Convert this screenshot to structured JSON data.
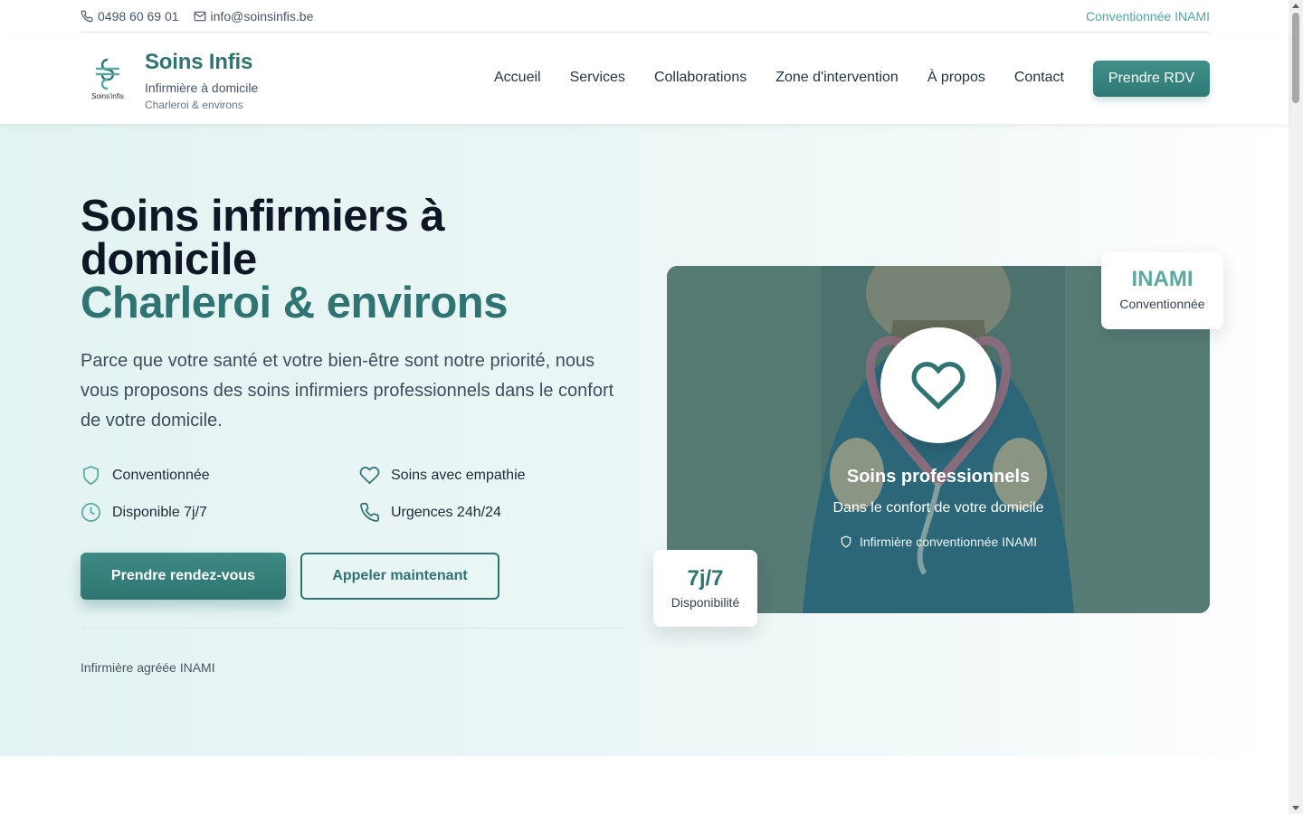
{
  "topbar": {
    "phone": "0498 60 69 01",
    "email": "info@soinsinfis.be",
    "badge": "Conventionnée INAMI"
  },
  "header": {
    "brand_name": "Soins Infis",
    "brand_sub": "Infirmière à domicile",
    "brand_loc": "Charleroi & environs",
    "logo_text": "Soins'infis",
    "nav": [
      "Accueil",
      "Services",
      "Collaborations",
      "Zone d'intervention",
      "À propos",
      "Contact"
    ],
    "cta": "Prendre RDV"
  },
  "hero": {
    "title_line1": "Soins infirmiers à",
    "title_line2": "domicile",
    "title_accent": "Charleroi & environs",
    "description": "Parce que votre santé et votre bien-être sont notre priorité, nous vous proposons des soins infirmiers professionnels dans le confort de votre domicile.",
    "features": [
      {
        "icon": "shield-icon",
        "label": "Conventionnée"
      },
      {
        "icon": "heart-icon",
        "label": "Soins avec empathie"
      },
      {
        "icon": "clock-icon",
        "label": "Disponible 7j/7"
      },
      {
        "icon": "phone-icon",
        "label": "Urgences 24h/24"
      }
    ],
    "btn_primary": "Prendre rendez-vous",
    "btn_secondary": "Appeler maintenant",
    "note": "Infirmière agréée INAMI"
  },
  "card": {
    "title": "Soins professionnels",
    "subtitle": "Dans le confort de votre domicile",
    "note": "Infirmière conventionnée INAMI",
    "badge_inami_big": "INAMI",
    "badge_inami_small": "Conventionnée",
    "badge_7j_big": "7j/7",
    "badge_7j_small": "Disponibilité"
  },
  "colors": {
    "primary": "#2f7372",
    "accent": "#4fa8a0",
    "hero_bg": "#e3f3f2"
  }
}
